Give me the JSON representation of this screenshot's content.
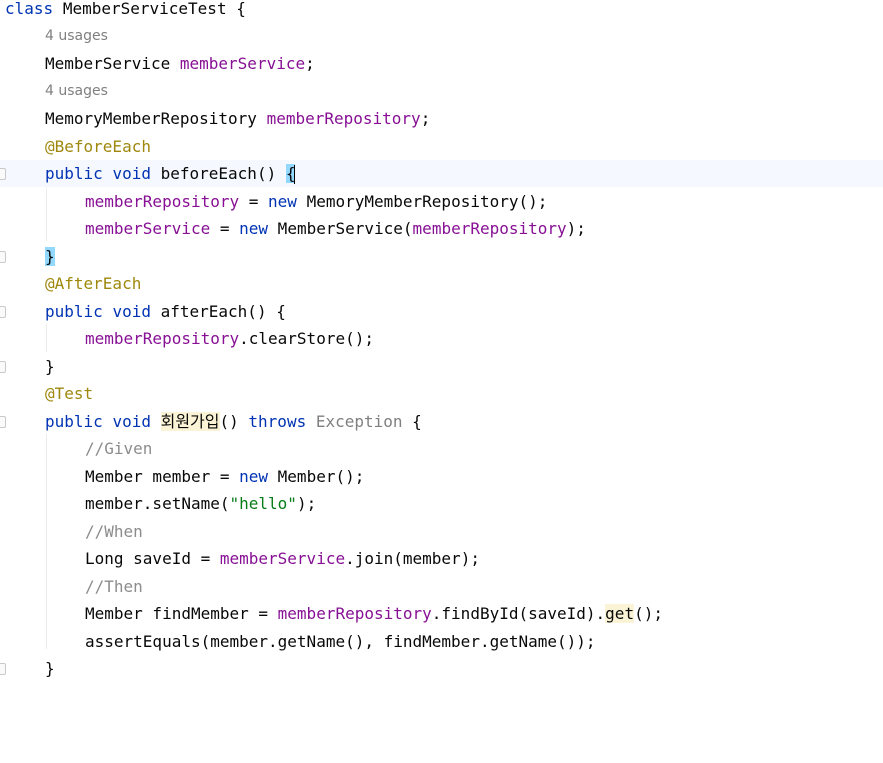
{
  "editor": {
    "class_decl": {
      "kw": "class",
      "name": "MemberServiceTest",
      "brace": "{"
    },
    "usage_hint_1": "4 usages",
    "field_1": {
      "type": "MemberService",
      "name": "memberService",
      "semi": ";"
    },
    "usage_hint_2": "4 usages",
    "field_2": {
      "type": "MemoryMemberRepository",
      "name": "memberRepository",
      "semi": ";"
    },
    "before_each_ann": "@BeforeEach",
    "before_each_sig": {
      "public": "public",
      "void": "void",
      "name": "beforeEach()",
      "brace": "{"
    },
    "before_each_body_1": {
      "target": "memberRepository",
      "eq": " = ",
      "new": "new",
      "rest": " MemoryMemberRepository();"
    },
    "before_each_body_2": {
      "target": "memberService",
      "eq": " = ",
      "new": "new",
      "ctor": " MemberService(",
      "arg": "memberRepository",
      "end": ");"
    },
    "before_each_close": "}",
    "after_each_ann": "@AfterEach",
    "after_each_sig": {
      "public": "public",
      "void": "void",
      "name": "afterEach() {"
    },
    "after_each_body": {
      "target": "memberRepository",
      "rest": ".clearStore();"
    },
    "after_each_close": "}",
    "test_ann": "@Test",
    "test_sig": {
      "public": "public",
      "void": "void",
      "name": "회원가입",
      "paren": "() ",
      "throws": "throws",
      "exc": "Exception",
      "brace": " {"
    },
    "comment_given": "//Given",
    "stmt_member": {
      "pre": "Member member = ",
      "new": "new",
      "rest": " Member();"
    },
    "stmt_setname": {
      "pre": "member.setName(",
      "str": "\"hello\"",
      "end": ");"
    },
    "comment_when": "//When",
    "stmt_join": {
      "pre": "Long saveId = ",
      "field": "memberService",
      "rest": ".join(member);"
    },
    "comment_then": "//Then",
    "stmt_find": {
      "pre": "Member findMember = ",
      "field": "memberRepository",
      "mid": ".findById(saveId).",
      "get": "get",
      "end": "();"
    },
    "stmt_assert": "assertEquals(member.getName(), findMember.getName());",
    "test_close": "}"
  },
  "colors": {
    "keyword": "#0033b3",
    "field": "#871094",
    "annotation": "#9e880d",
    "comment": "#8c8c8c",
    "string": "#067d17",
    "current_line": "#f5f8fe",
    "brace_match": "#93d9ff"
  }
}
